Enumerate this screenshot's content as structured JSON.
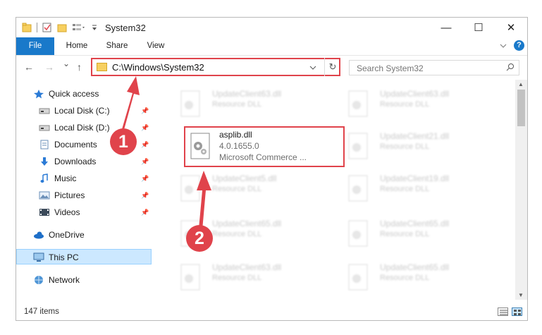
{
  "window": {
    "title": "System32",
    "controls": {
      "minimize": "—",
      "maximize": "☐",
      "close": "✕"
    }
  },
  "ribbon": {
    "tabs": [
      "File",
      "Home",
      "Share",
      "View"
    ],
    "collapse_icon": "chevron-down-icon",
    "help_label": "?"
  },
  "nav": {
    "back_icon": "←",
    "forward_icon": "→",
    "recent_icon": "⌄",
    "up_icon": "↑",
    "address": "C:\\Windows\\System32",
    "refresh_icon": "↻",
    "search_placeholder": "Search System32"
  },
  "sidebar": {
    "items": [
      {
        "label": "Quick access",
        "icon": "star-icon"
      },
      {
        "label": "Local Disk (C:)",
        "icon": "drive-icon",
        "pinned": true
      },
      {
        "label": "Local Disk (D:)",
        "icon": "drive-icon",
        "pinned": true
      },
      {
        "label": "Documents",
        "icon": "documents-icon",
        "pinned": true
      },
      {
        "label": "Downloads",
        "icon": "download-icon",
        "pinned": true
      },
      {
        "label": "Music",
        "icon": "music-icon",
        "pinned": true
      },
      {
        "label": "Pictures",
        "icon": "pictures-icon",
        "pinned": true
      },
      {
        "label": "Videos",
        "icon": "videos-icon",
        "pinned": true
      },
      {
        "label": "OneDrive",
        "icon": "cloud-icon"
      },
      {
        "label": "This PC",
        "icon": "computer-icon",
        "selected": true
      },
      {
        "label": "Network",
        "icon": "network-icon"
      }
    ]
  },
  "files": {
    "col1": [
      {
        "name": "UpdateClient63.dll",
        "desc": "Resource DLL"
      },
      {
        "name": "UpdateClient5.dll",
        "desc": "Resource DLL"
      },
      {
        "name": "UpdateClient65.dll",
        "desc": "Resource DLL"
      },
      {
        "name": "UpdateClient63.dll",
        "desc": "Resource DLL"
      }
    ],
    "col2": [
      {
        "name": "UpdateClient63.dll",
        "desc": "Resource DLL"
      },
      {
        "name": "UpdateClient21.dll",
        "desc": "Resource DLL"
      },
      {
        "name": "UpdateClient19.dll",
        "desc": "Resource DLL"
      },
      {
        "name": "UpdateClient65.dll",
        "desc": "Resource DLL"
      },
      {
        "name": "UpdateClient65.dll",
        "desc": "Resource DLL"
      }
    ],
    "selected": {
      "name": "asplib.dll",
      "version": "4.0.1655.0",
      "company": "Microsoft Commerce ..."
    }
  },
  "status": {
    "items_count": "147 items"
  },
  "annotations": {
    "step1": "1",
    "step2": "2",
    "color": "#e0434b"
  }
}
